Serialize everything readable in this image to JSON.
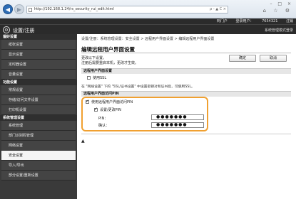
{
  "browser": {
    "url": "http://192.168.1.24/rs_security_rui_edit.html",
    "addr_tools": "ρ - ▲ C ×",
    "win_controls": "– □ ×",
    "tool_icons": "⌂ ☆ ⚙"
  },
  "header": {
    "links": [
      "到门户",
      "登录用户：",
      "7654321",
      "注销"
    ],
    "title": "设置/注册",
    "right_text": "系统管理模式登录"
  },
  "sidebar": {
    "groups": [
      {
        "category": "偏好设置",
        "items": [
          "纸张设置",
          "显示设置",
          "定时器设置",
          "音量设置"
        ]
      },
      {
        "category": "功能设置",
        "items": [
          "常规设置",
          "存储/访问文件设置",
          "打印机设置"
        ]
      },
      {
        "category": "系统管理设置",
        "items": [
          "系统管理",
          "部门识别码管理",
          "网络设置",
          "安全设置",
          "导入/导出",
          "部分设置/重新设置"
        ]
      }
    ],
    "active": "安全设置"
  },
  "main": {
    "breadcrumb": "设置/注册：系统管理设置：安全设置 > 远程用户界面设置 > 编辑远程用户界面设置",
    "title": "编辑远程用户界面设置",
    "note1": "更改以下设置。",
    "note2": "注册后需要重启本机，更改才生效。",
    "ok_label": "确定",
    "cancel_label": "取消",
    "section1_title": "远程用户界面设置",
    "ssl_label": "使用SSL",
    "ssl_checked": false,
    "ssl_note": "在 \"网络设置\" 下的 \"SSL/证书设置\" 中设置密钥对和证书后，可使用SSL。",
    "section2_title": "远程用户界面访问PIN",
    "use_pin_label": "使用远程用户界面访问PIN",
    "use_pin_checked": true,
    "set_pin_label": "设置/更改PIN",
    "set_pin_checked": true,
    "pin_label": "PIN：",
    "pin_value": "●●●●●●●",
    "confirm_label": "确认：",
    "confirm_value": "●●●●●●●",
    "top_link": "▲"
  }
}
